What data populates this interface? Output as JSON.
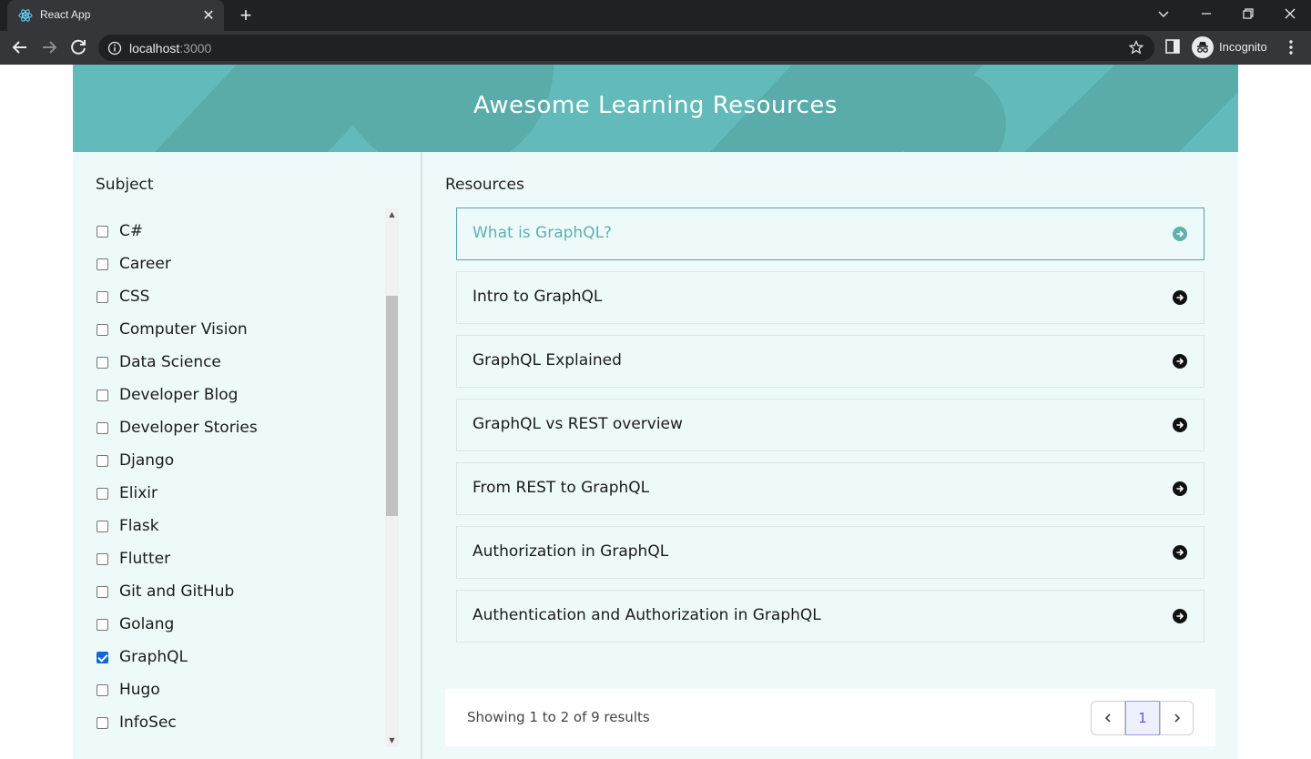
{
  "browser": {
    "tab_title": "React App",
    "url_host": "localhost",
    "url_port": ":3000",
    "profile_label": "Incognito"
  },
  "page": {
    "title": "Awesome Learning Resources",
    "subject_heading": "Subject",
    "resources_heading": "Resources",
    "subjects": [
      {
        "label": "C#",
        "checked": false
      },
      {
        "label": "Career",
        "checked": false
      },
      {
        "label": "CSS",
        "checked": false
      },
      {
        "label": "Computer Vision",
        "checked": false
      },
      {
        "label": "Data Science",
        "checked": false
      },
      {
        "label": "Developer Blog",
        "checked": false
      },
      {
        "label": "Developer Stories",
        "checked": false
      },
      {
        "label": "Django",
        "checked": false
      },
      {
        "label": "Elixir",
        "checked": false
      },
      {
        "label": "Flask",
        "checked": false
      },
      {
        "label": "Flutter",
        "checked": false
      },
      {
        "label": "Git and GitHub",
        "checked": false
      },
      {
        "label": "Golang",
        "checked": false
      },
      {
        "label": "GraphQL",
        "checked": true
      },
      {
        "label": "Hugo",
        "checked": false
      },
      {
        "label": "InfoSec",
        "checked": false
      }
    ],
    "resources": [
      {
        "title": "What is GraphQL?",
        "active": true
      },
      {
        "title": "Intro to GraphQL",
        "active": false
      },
      {
        "title": "GraphQL Explained",
        "active": false
      },
      {
        "title": "GraphQL vs REST overview",
        "active": false
      },
      {
        "title": "From REST to GraphQL",
        "active": false
      },
      {
        "title": "Authorization in GraphQL",
        "active": false
      },
      {
        "title": "Authentication and Authorization in GraphQL",
        "active": false
      }
    ],
    "pagination": {
      "summary": "Showing 1 to 2 of 9 results",
      "current_page": "1"
    }
  },
  "colors": {
    "hero": "#62baba",
    "accent": "#5fb0ae",
    "page_bg": "#eefaf9",
    "checkbox_checked": "#0b68d6"
  }
}
